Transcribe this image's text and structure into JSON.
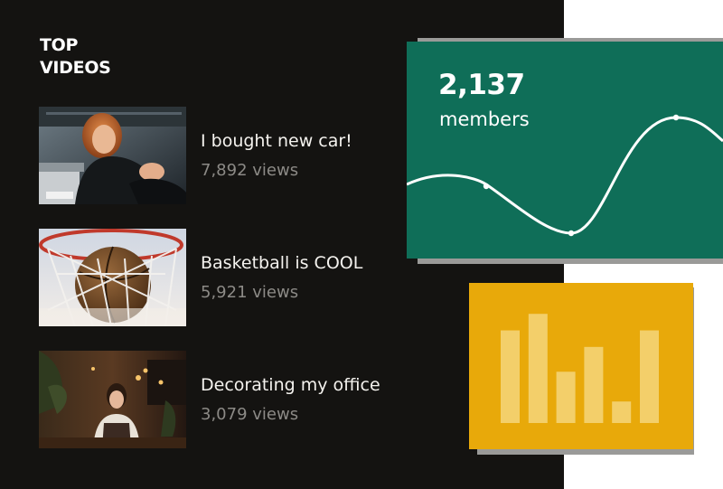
{
  "section": {
    "heading_line1": "TOP",
    "heading_line2": "VIDEOS"
  },
  "videos": [
    {
      "title": "I bought new car!",
      "views": "7,892 views",
      "thumbnail": "woman-in-parking-garage"
    },
    {
      "title": "Basketball is COOL",
      "views": "5,921 views",
      "thumbnail": "basketball-in-hoop"
    },
    {
      "title": "Decorating my office",
      "views": "3,079 views",
      "thumbnail": "woman-in-office"
    }
  ],
  "members_card": {
    "count": "2,137",
    "label": "members",
    "color": "#0f6e58",
    "trend": [
      0.25,
      0.45,
      0.1,
      0.95,
      0.55
    ]
  },
  "bar_card": {
    "color": "#e8a90a",
    "bar_color": "#f3cf6a",
    "values": [
      0.56,
      0.66,
      0.31,
      0.46,
      0.13,
      0.56
    ]
  }
}
